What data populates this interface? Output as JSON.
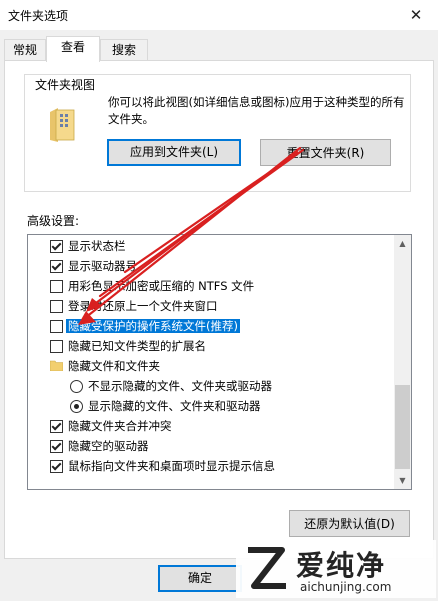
{
  "window": {
    "title": "文件夹选项",
    "close_glyph": "✕"
  },
  "tabs": [
    {
      "label": "常规"
    },
    {
      "label": "查看"
    },
    {
      "label": "搜索"
    }
  ],
  "folder_views": {
    "group_title": "文件夹视图",
    "description": "你可以将此视图(如详细信息或图标)应用于这种类型的所有文件夹。",
    "apply_button": "应用到文件夹(L)",
    "reset_button": "重置文件夹(R)"
  },
  "advanced": {
    "label": "高级设置:",
    "items": [
      {
        "type": "checkbox",
        "checked": true,
        "label": "显示状态栏"
      },
      {
        "type": "checkbox",
        "checked": true,
        "label": "显示驱动器号"
      },
      {
        "type": "checkbox",
        "checked": false,
        "label": "用彩色显示加密或压缩的 NTFS 文件"
      },
      {
        "type": "checkbox",
        "checked": false,
        "label": "登录时还原上一个文件夹窗口"
      },
      {
        "type": "checkbox",
        "checked": false,
        "label": "隐藏受保护的操作系统文件(推荐)",
        "selected": true
      },
      {
        "type": "checkbox",
        "checked": false,
        "label": "隐藏已知文件类型的扩展名"
      },
      {
        "type": "folder",
        "label": "隐藏文件和文件夹"
      },
      {
        "type": "radio",
        "checked": false,
        "label": "不显示隐藏的文件、文件夹或驱动器"
      },
      {
        "type": "radio",
        "checked": true,
        "label": "显示隐藏的文件、文件夹和驱动器"
      },
      {
        "type": "checkbox",
        "checked": true,
        "label": "隐藏文件夹合并冲突"
      },
      {
        "type": "checkbox",
        "checked": true,
        "label": "隐藏空的驱动器"
      },
      {
        "type": "checkbox",
        "checked": true,
        "label": "鼠标指向文件夹和桌面项时显示提示信息"
      }
    ]
  },
  "restore_defaults_button": "还原为默认值(D)",
  "ok_button": "确定",
  "watermark": {
    "brand": "爱纯净",
    "url": "aichunjing.com"
  },
  "colors": {
    "accent": "#0078d7",
    "annotation": "#d92020"
  }
}
